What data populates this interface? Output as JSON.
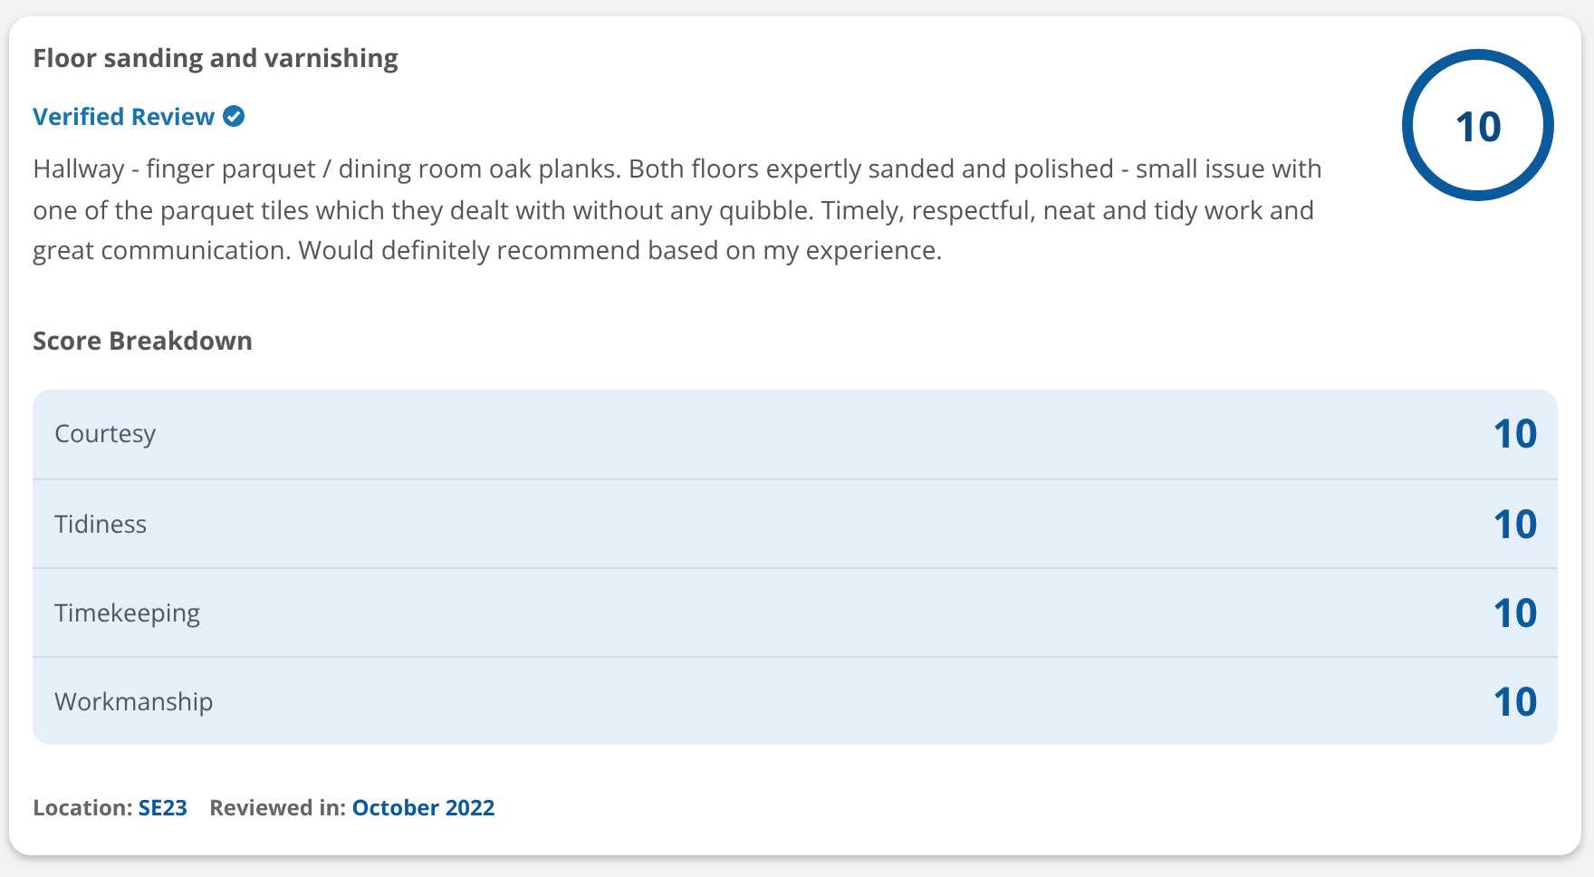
{
  "review": {
    "title": "Floor sanding and varnishing",
    "verified_label": "Verified Review",
    "score": "10",
    "body": "Hallway - finger parquet / dining room oak planks. Both floors expertly sanded and polished - small issue with one of the parquet tiles which they dealt with without any quibble. Timely, respectful, neat and tidy work and great communication. Would definitely recommend based on my experience."
  },
  "breakdown": {
    "title": "Score Breakdown",
    "rows": [
      {
        "label": "Courtesy",
        "score": "10"
      },
      {
        "label": "Tidiness",
        "score": "10"
      },
      {
        "label": "Timekeeping",
        "score": "10"
      },
      {
        "label": "Workmanship",
        "score": "10"
      }
    ]
  },
  "footer": [
    {
      "label": "Location:",
      "value": "SE23"
    },
    {
      "label": "Reviewed in:",
      "value": "October 2022"
    }
  ]
}
